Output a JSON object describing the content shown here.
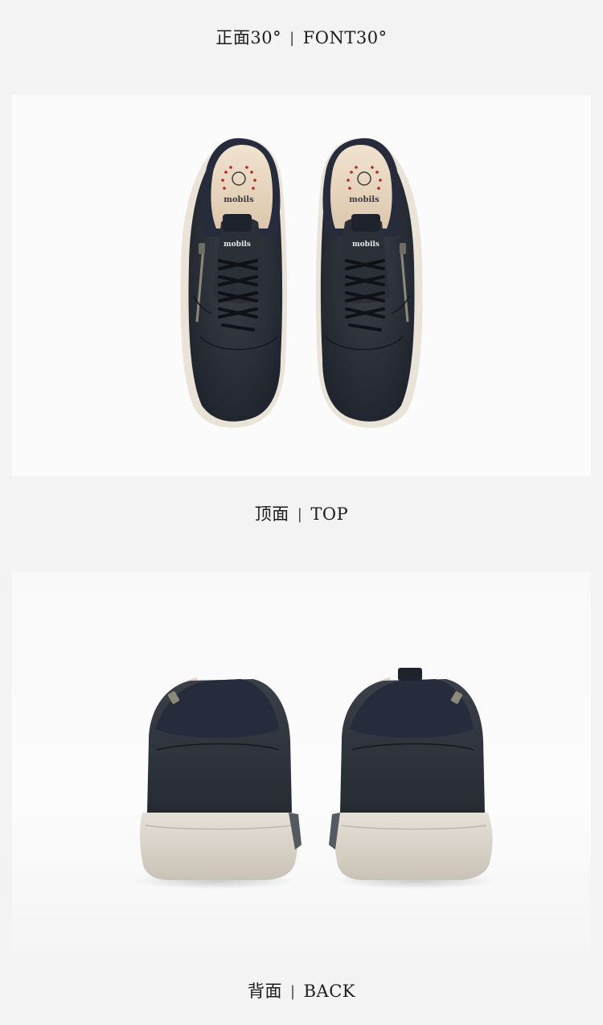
{
  "captions": {
    "front": {
      "zh": "正面30°",
      "separator": "|",
      "en": "FONT30°"
    },
    "top": {
      "zh": "顶面",
      "separator": "|",
      "en": "TOP"
    },
    "back": {
      "zh": "背面",
      "separator": "|",
      "en": "BACK"
    }
  },
  "brand": {
    "logo_text": "mobils",
    "insole_text": "mobils"
  },
  "colors": {
    "page_background": "#f3f3f3",
    "panel_background": "#fbfbfb",
    "leather": "#2c3038",
    "suede": "#262c3b",
    "lining": "#ead9c4",
    "sole": "#d8d2c7",
    "brand_red": "#b1262b"
  }
}
